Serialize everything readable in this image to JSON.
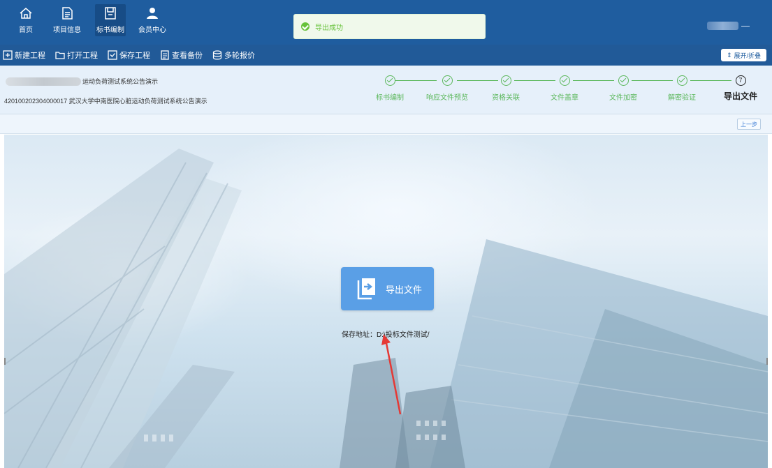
{
  "nav": {
    "items": [
      {
        "label": "首页",
        "icon": "home-icon"
      },
      {
        "label": "项目信息",
        "icon": "document-icon"
      },
      {
        "label": "标书编制",
        "icon": "save-book-icon",
        "active": true
      },
      {
        "label": "会员中心",
        "icon": "user-icon"
      }
    ]
  },
  "toast": {
    "message": "导出成功",
    "color": "#67c23a"
  },
  "toolbar": {
    "buttons": [
      {
        "label": "新建工程",
        "icon": "new-project-icon"
      },
      {
        "label": "打开工程",
        "icon": "folder-icon"
      },
      {
        "label": "保存工程",
        "icon": "save-icon"
      },
      {
        "label": "查看备份",
        "icon": "backup-icon"
      },
      {
        "label": "多轮报价",
        "icon": "database-icon"
      }
    ],
    "expand_label": "展开/折叠"
  },
  "project": {
    "name_suffix": "运动负荷测试系统公告演示",
    "code_line": "420100202304000017 武汉大学中南医院心脏运动负荷测试系统公告演示"
  },
  "steps": {
    "items": [
      {
        "label": "标书编制",
        "status": "done"
      },
      {
        "label": "响应文件预览",
        "status": "done"
      },
      {
        "label": "资格关联",
        "status": "done"
      },
      {
        "label": "文件盖章",
        "status": "done"
      },
      {
        "label": "文件加密",
        "status": "done"
      },
      {
        "label": "解密验证",
        "status": "done"
      },
      {
        "label": "导出文件",
        "status": "current",
        "number": "7"
      }
    ],
    "done_color": "#5cb85c"
  },
  "prev_button": "上一步",
  "export": {
    "button_label": "导出文件",
    "save_path": "保存地址：D:\\投标文件测试/",
    "accent": "#5a9fe6"
  },
  "colors": {
    "nav_bg": "#1f5d9f",
    "toolbar_bg": "#215a98",
    "arrow": "#e53935"
  }
}
